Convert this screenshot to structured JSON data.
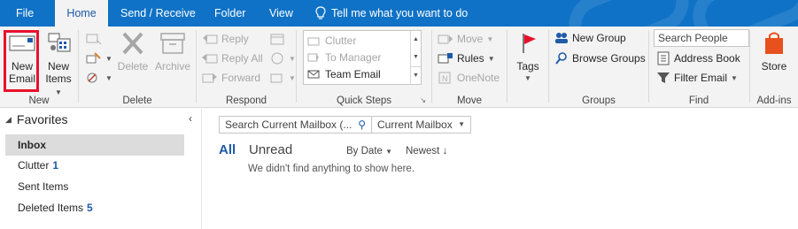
{
  "tabs": [
    {
      "label": "File"
    },
    {
      "label": "Home"
    },
    {
      "label": "Send / Receive"
    },
    {
      "label": "Folder"
    },
    {
      "label": "View"
    }
  ],
  "tell_me": "Tell me what you want to do",
  "ribbon": {
    "new": {
      "group_label": "New",
      "new_email_line1": "New",
      "new_email_line2": "Email",
      "new_items_line1": "New",
      "new_items_line2": "Items"
    },
    "delete": {
      "group_label": "Delete",
      "delete_label": "Delete",
      "archive_label": "Archive"
    },
    "respond": {
      "group_label": "Respond",
      "reply": "Reply",
      "reply_all": "Reply All",
      "forward": "Forward"
    },
    "quick_steps": {
      "group_label": "Quick Steps",
      "items": [
        "Clutter",
        "To Manager",
        "Team Email"
      ]
    },
    "move": {
      "group_label": "Move",
      "move": "Move",
      "rules": "Rules",
      "onenote": "OneNote"
    },
    "tags": {
      "label": "Tags"
    },
    "groups": {
      "group_label": "Groups",
      "new_group": "New Group",
      "browse_groups": "Browse Groups"
    },
    "find": {
      "group_label": "Find",
      "search_people": "Search People",
      "address_book": "Address Book",
      "filter_email": "Filter Email"
    },
    "addins": {
      "group_label": "Add-ins",
      "store": "Store"
    }
  },
  "favorites": {
    "title": "Favorites",
    "folders": [
      {
        "name": "Inbox",
        "count": ""
      },
      {
        "name": "Clutter",
        "count": "1"
      },
      {
        "name": "Sent Items",
        "count": ""
      },
      {
        "name": "Deleted Items",
        "count": "5"
      }
    ]
  },
  "message_list": {
    "search_placeholder": "Search Current Mailbox (...",
    "scope": "Current Mailbox",
    "filter_all": "All",
    "filter_unread": "Unread",
    "sort_by": "By Date",
    "order": "Newest",
    "empty_message": "We didn't find anything to show here."
  },
  "colors": {
    "accent": "#0f72c6",
    "highlight": "#e8112d"
  }
}
